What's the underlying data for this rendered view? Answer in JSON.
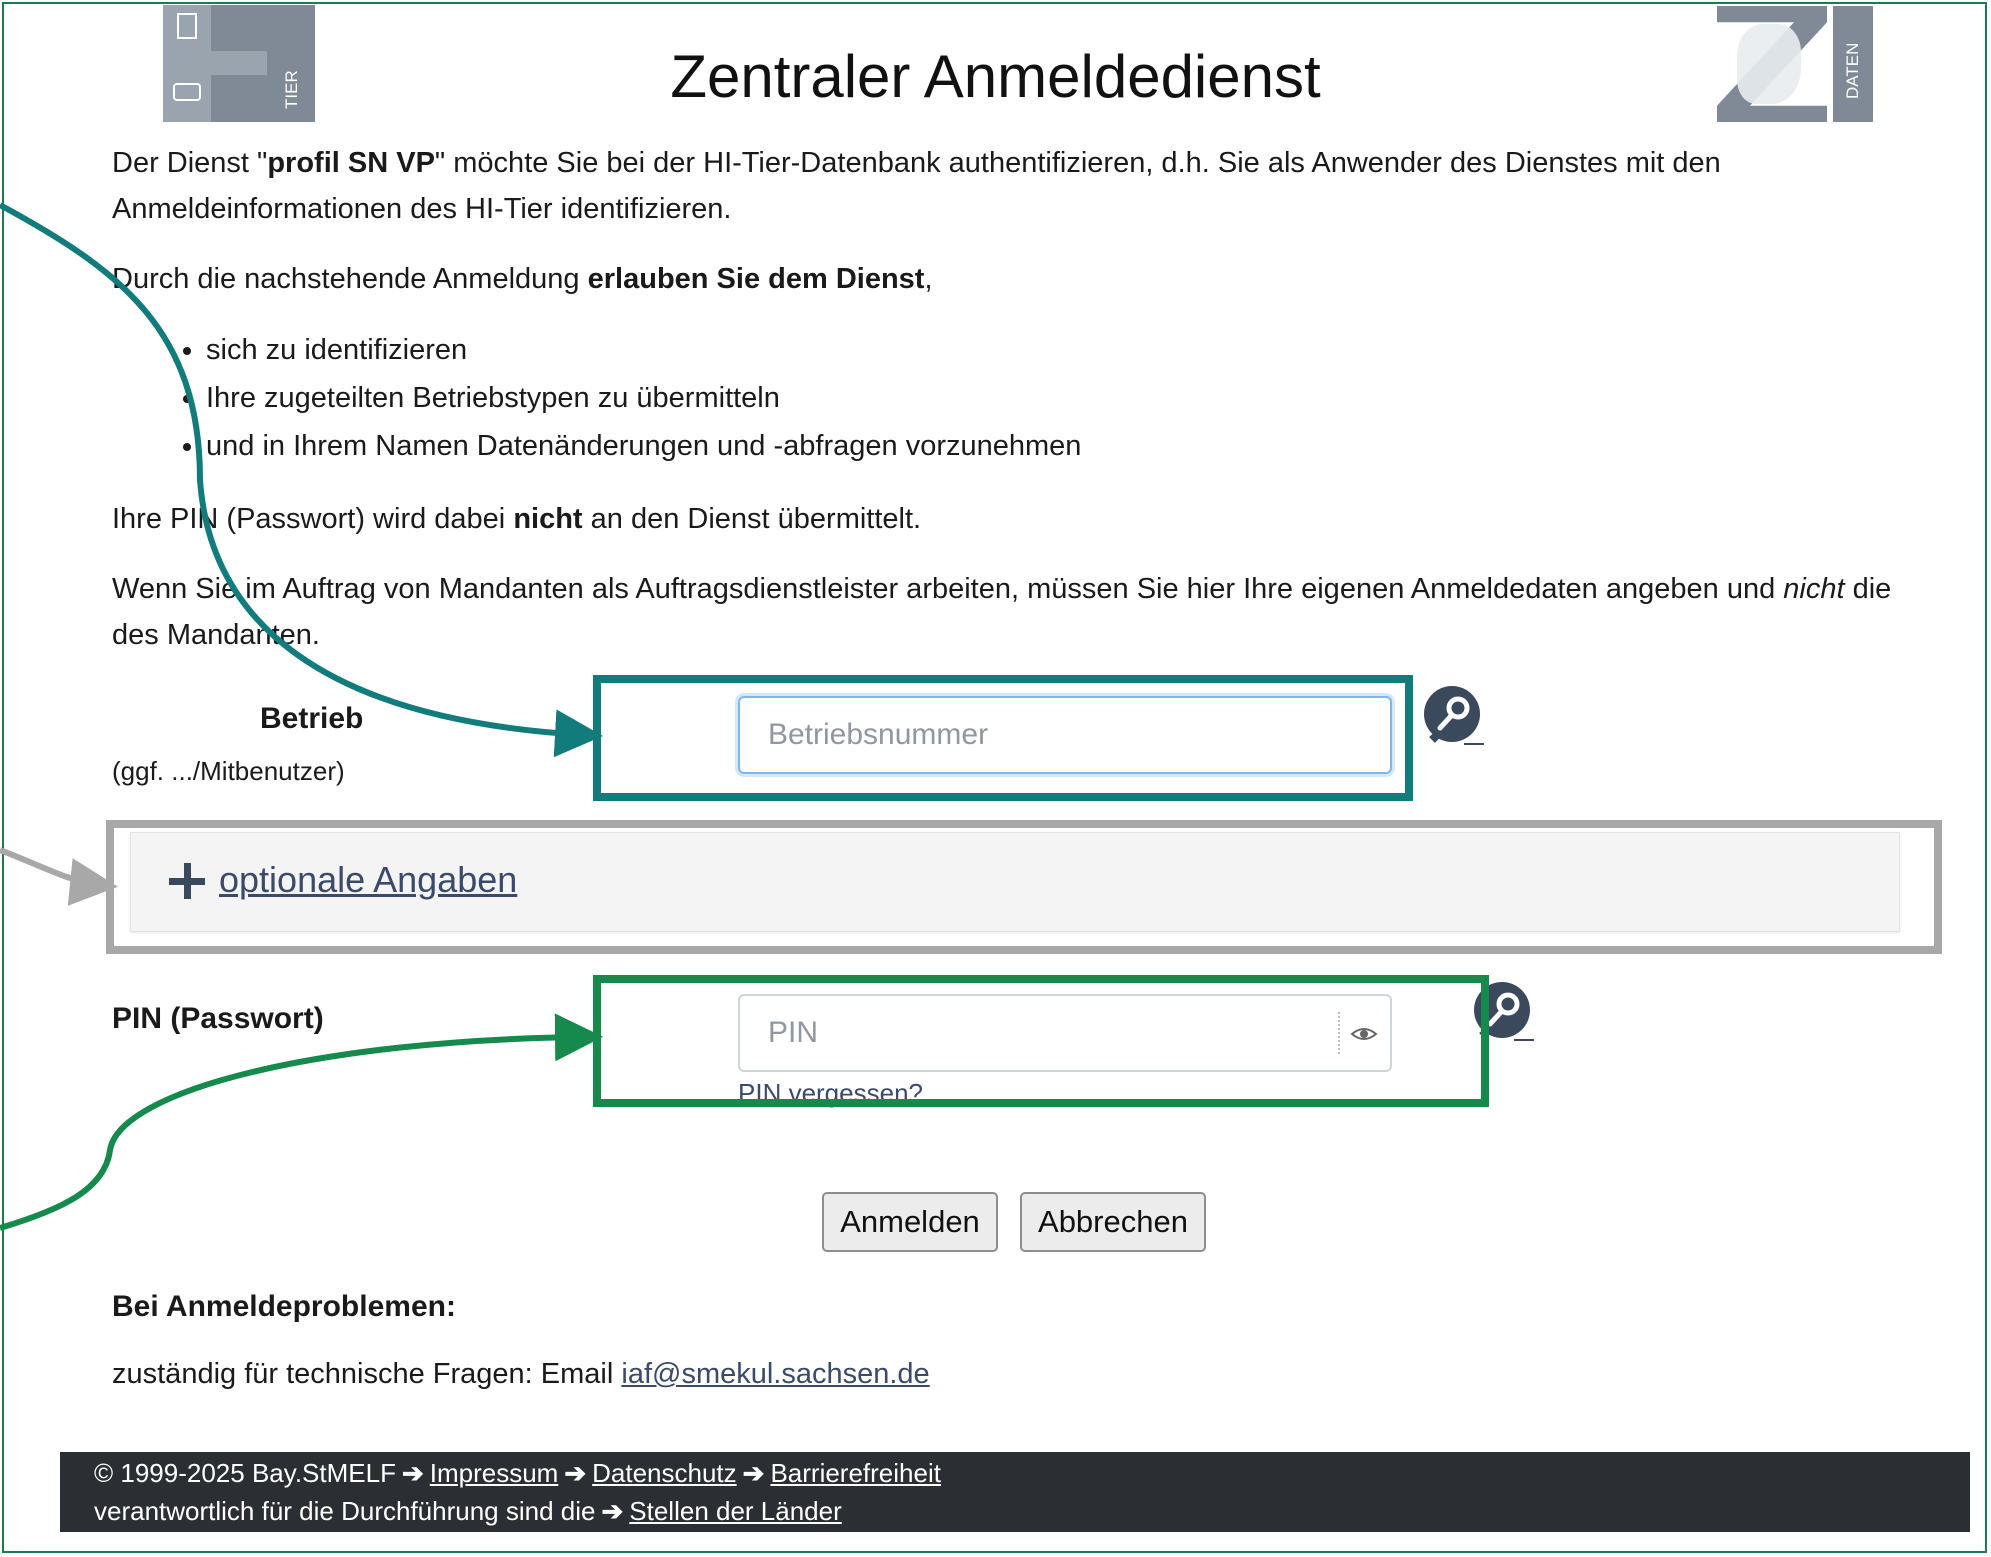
{
  "header": {
    "title": "Zentraler Anmeldedienst",
    "logo_left_text": "TIER",
    "logo_right_text": "DATEN"
  },
  "intro": {
    "p1_a": "Der Dienst \"",
    "p1_service": "profil SN VP",
    "p1_b": "\" möchte Sie bei der HI-Tier-Datenbank authentifizieren, d.h. Sie als Anwender des Dienstes mit den Anmeldeinformationen des HI-Tier identifizieren.",
    "p2_a": "Durch die nachstehende Anmeldung ",
    "p2_b": "erlauben Sie dem Dienst",
    "p2_c": ",",
    "rights": [
      "sich zu identifizieren",
      "Ihre zugeteilten Betriebstypen zu übermitteln",
      "und in Ihrem Namen Datenänderungen und -abfragen vorzunehmen"
    ],
    "p3_a": "Ihre PIN (Passwort) wird dabei ",
    "p3_b": "nicht",
    "p3_c": " an den Dienst übermittelt.",
    "p4_a": "Wenn Sie im Auftrag von Mandanten als Auftragsdienstleister arbeiten, müssen Sie hier Ihre eigenen Anmeldedaten angeben und ",
    "p4_b": "nicht",
    "p4_c": " die des Mandanten."
  },
  "form": {
    "betrieb_label": "Betrieb",
    "betrieb_sub": "(ggf. .../Mitbenutzer)",
    "betrieb_placeholder": "Betriebsnummer",
    "betrieb_value": "",
    "optional_label": " optionale Angaben",
    "pin_label": "PIN (Passwort)",
    "pin_placeholder": "PIN",
    "pin_value": "",
    "pin_forgot_link": "PIN vergessen",
    "pin_forgot_suffix": "?",
    "login_button": "Anmelden",
    "cancel_button": "Abbrechen"
  },
  "support": {
    "heading": "Bei Anmeldeproblemen:",
    "text": "zuständig für technische Fragen: Email ",
    "email": "iaf@smekul.sachsen.de"
  },
  "footer": {
    "copyright": "© 1999-2025 Bay.StMELF",
    "impressum": "Impressum",
    "datenschutz": "Datenschutz",
    "barrierefreiheit": "Barrierefreiheit",
    "responsible": "verantwortlich für die Durchführung sind die",
    "stellen": "Stellen der Länder",
    "arrow_glyph": "➔"
  },
  "colors": {
    "teal_highlight": "#127c7c",
    "grey_highlight": "#a8a8a8",
    "green_highlight": "#168a4c",
    "footer_bg": "#2b2f33",
    "frame_border": "#1e7a4e"
  }
}
